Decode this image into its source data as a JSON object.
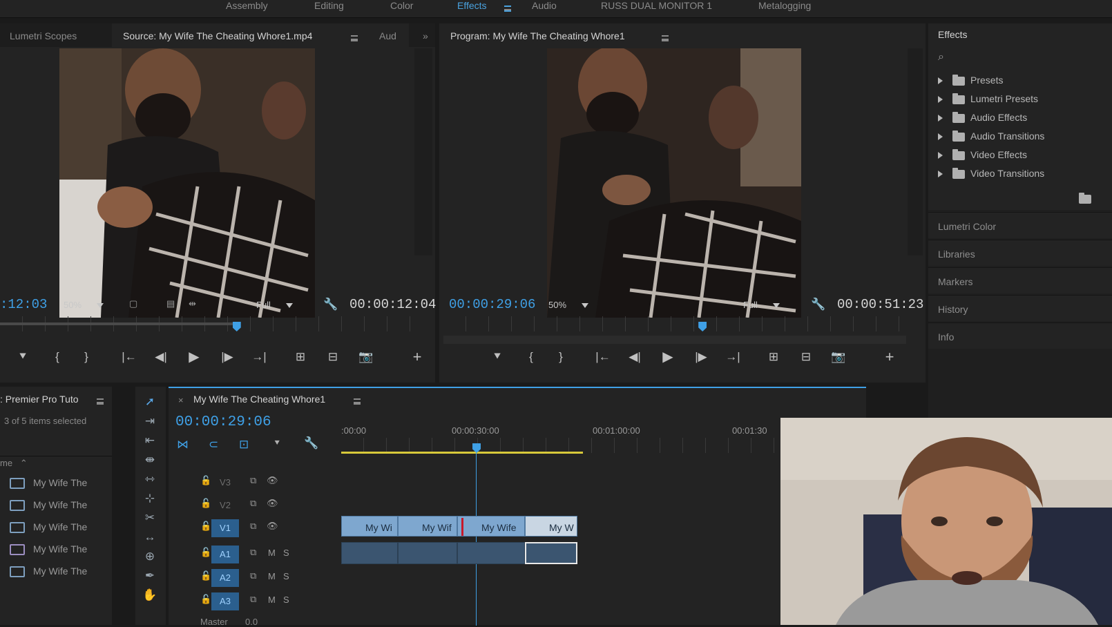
{
  "workspaces": [
    {
      "label": "Assembly",
      "active": false
    },
    {
      "label": "Editing",
      "active": false
    },
    {
      "label": "Color",
      "active": false
    },
    {
      "label": "Effects",
      "active": true
    },
    {
      "label": "Audio",
      "active": false
    },
    {
      "label": "RUSS DUAL MONITOR 1",
      "active": false
    },
    {
      "label": "Metalogging",
      "active": false
    }
  ],
  "source_panel": {
    "tabs": [
      "Lumetri Scopes",
      "Source: My Wife The Cheating Whore1.mp4",
      "Aud"
    ],
    "overflow_glyph": "»",
    "timecode_left": ":12:03",
    "zoom": "50%",
    "resolution": "Full",
    "timecode_right": "00:00:12:04",
    "playhead_fraction": 0.56
  },
  "program_panel": {
    "tab": "Program: My Wife The Cheating Whore1",
    "timecode_left": "00:00:29:06",
    "zoom": "50%",
    "resolution": "Full",
    "timecode_right": "00:00:51:23",
    "playhead_fraction": 0.56
  },
  "transport": {
    "marker": "⯆",
    "in": "{",
    "out": "}",
    "go_in": "|←",
    "step_back": "◀|",
    "play": "▶",
    "step_fwd": "|▶",
    "go_out": "→|",
    "insert": "⊞",
    "overwrite": "⊟",
    "export_frame": "📷",
    "add": "+"
  },
  "effects_panel": {
    "title": "Effects",
    "search_glyph": "⌕",
    "items": [
      "Presets",
      "Lumetri Presets",
      "Audio Effects",
      "Audio Transitions",
      "Video Effects",
      "Video Transitions"
    ],
    "collapsed_panels": [
      "Lumetri Color",
      "Libraries",
      "Markers",
      "History",
      "Info"
    ]
  },
  "project_panel": {
    "title": ": Premier Pro Tuto",
    "selection": "3 of 5 items selected",
    "sort_label": "me",
    "items": [
      "My Wife The",
      "My Wife The",
      "My Wife The",
      "My Wife The",
      "My Wife The"
    ]
  },
  "timeline": {
    "close_glyph": "×",
    "sequence_name": "My Wife The Cheating Whore1",
    "timecode": "00:00:29:06",
    "ruler_labels": [
      ":00:00",
      "00:00:30:00",
      "00:01:00:00",
      "00:01:30"
    ],
    "video_tracks": [
      {
        "label": "V3",
        "targeted": false
      },
      {
        "label": "V2",
        "targeted": false
      },
      {
        "label": "V1",
        "targeted": true
      }
    ],
    "audio_tracks": [
      {
        "label": "A1",
        "m": "M",
        "s": "S"
      },
      {
        "label": "A2",
        "m": "M",
        "s": "S"
      },
      {
        "label": "A3",
        "m": "M",
        "s": "S"
      }
    ],
    "master_label": "Master",
    "master_value": "0.0",
    "clips": [
      "My Wi",
      "My Wif",
      "My Wife",
      "My W"
    ]
  },
  "colors": {
    "accent_blue": "#3fa0e6",
    "clip_blue": "#7ea7cf",
    "work_area_yellow": "#d8c93a"
  }
}
